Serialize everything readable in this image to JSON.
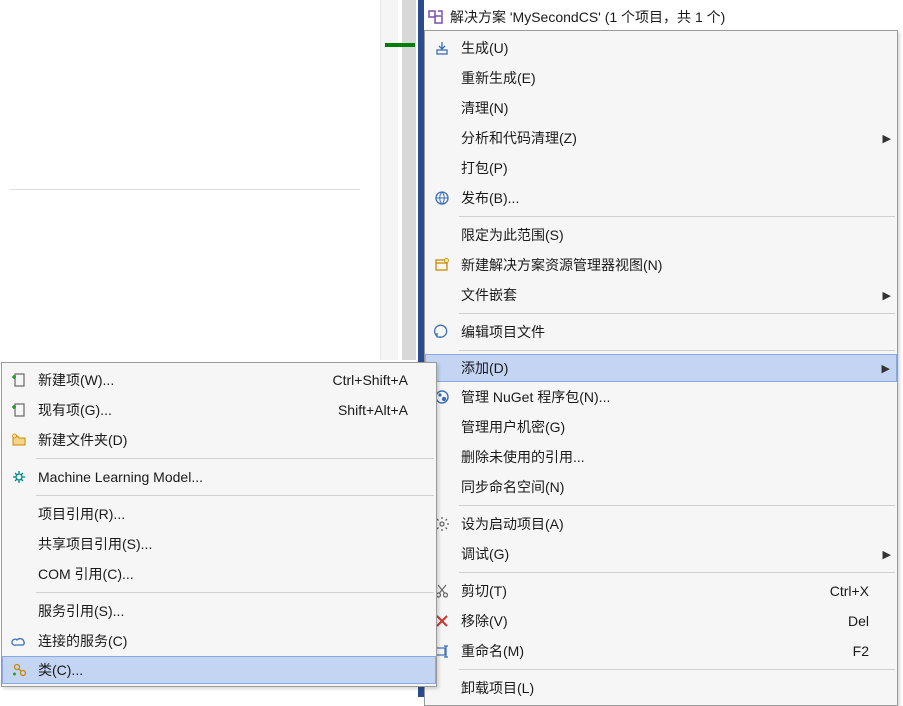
{
  "solution_header": {
    "text": "解决方案 'MySecondCS' (1 个项目，共 1 个)"
  },
  "right_menu": {
    "items": [
      {
        "id": "build",
        "icon": "build-icon",
        "label": "生成(U)"
      },
      {
        "id": "rebuild",
        "icon": "",
        "label": "重新生成(E)"
      },
      {
        "id": "clean",
        "icon": "",
        "label": "清理(N)"
      },
      {
        "id": "analyze",
        "icon": "",
        "label": "分析和代码清理(Z)",
        "submenu": true
      },
      {
        "id": "pack",
        "icon": "",
        "label": "打包(P)"
      },
      {
        "id": "publish",
        "icon": "globe-icon",
        "label": "发布(B)..."
      },
      {
        "sep": true
      },
      {
        "id": "scope",
        "icon": "",
        "label": "限定为此范围(S)"
      },
      {
        "id": "newview",
        "icon": "new-view-icon",
        "label": "新建解决方案资源管理器视图(N)"
      },
      {
        "id": "filenest",
        "icon": "",
        "label": "文件嵌套",
        "submenu": true
      },
      {
        "sep": true
      },
      {
        "id": "editproj",
        "icon": "edit-icon",
        "label": "编辑项目文件"
      },
      {
        "sep": true
      },
      {
        "id": "add",
        "icon": "",
        "label": "添加(D)",
        "submenu": true,
        "highlight": true
      },
      {
        "id": "nuget",
        "icon": "nuget-icon",
        "label": "管理 NuGet 程序包(N)..."
      },
      {
        "id": "secrets",
        "icon": "",
        "label": "管理用户机密(G)"
      },
      {
        "id": "removeref",
        "icon": "",
        "label": "删除未使用的引用..."
      },
      {
        "id": "syncns",
        "icon": "",
        "label": "同步命名空间(N)"
      },
      {
        "sep": true
      },
      {
        "id": "startup",
        "icon": "gear-icon",
        "label": "设为启动项目(A)"
      },
      {
        "id": "debug",
        "icon": "",
        "label": "调试(G)",
        "submenu": true
      },
      {
        "sep": true
      },
      {
        "id": "cut",
        "icon": "cut-icon",
        "label": "剪切(T)",
        "shortcut": "Ctrl+X"
      },
      {
        "id": "remove",
        "icon": "remove-icon",
        "label": "移除(V)",
        "shortcut": "Del"
      },
      {
        "id": "rename",
        "icon": "rename-icon",
        "label": "重命名(M)",
        "shortcut": "F2"
      },
      {
        "sep": true
      },
      {
        "id": "unload",
        "icon": "",
        "label": "卸载项目(L)"
      }
    ]
  },
  "left_menu": {
    "items": [
      {
        "id": "newitem",
        "icon": "new-item-icon",
        "label": "新建项(W)...",
        "shortcut": "Ctrl+Shift+A"
      },
      {
        "id": "existitem",
        "icon": "exist-item-icon",
        "label": "现有项(G)...",
        "shortcut": "Shift+Alt+A"
      },
      {
        "id": "newfolder",
        "icon": "folder-icon",
        "label": "新建文件夹(D)"
      },
      {
        "sep": true
      },
      {
        "id": "mlmodel",
        "icon": "ml-icon",
        "label": "Machine Learning Model..."
      },
      {
        "sep": true
      },
      {
        "id": "projref",
        "icon": "",
        "label": "项目引用(R)..."
      },
      {
        "id": "sharedref",
        "icon": "",
        "label": "共享项目引用(S)..."
      },
      {
        "id": "comref",
        "icon": "",
        "label": "COM 引用(C)..."
      },
      {
        "sep": true
      },
      {
        "id": "svcref",
        "icon": "",
        "label": "服务引用(S)..."
      },
      {
        "id": "connsvc",
        "icon": "cloud-icon",
        "label": "连接的服务(C)"
      },
      {
        "id": "class",
        "icon": "class-icon",
        "label": "类(C)...",
        "highlight": true
      }
    ]
  }
}
